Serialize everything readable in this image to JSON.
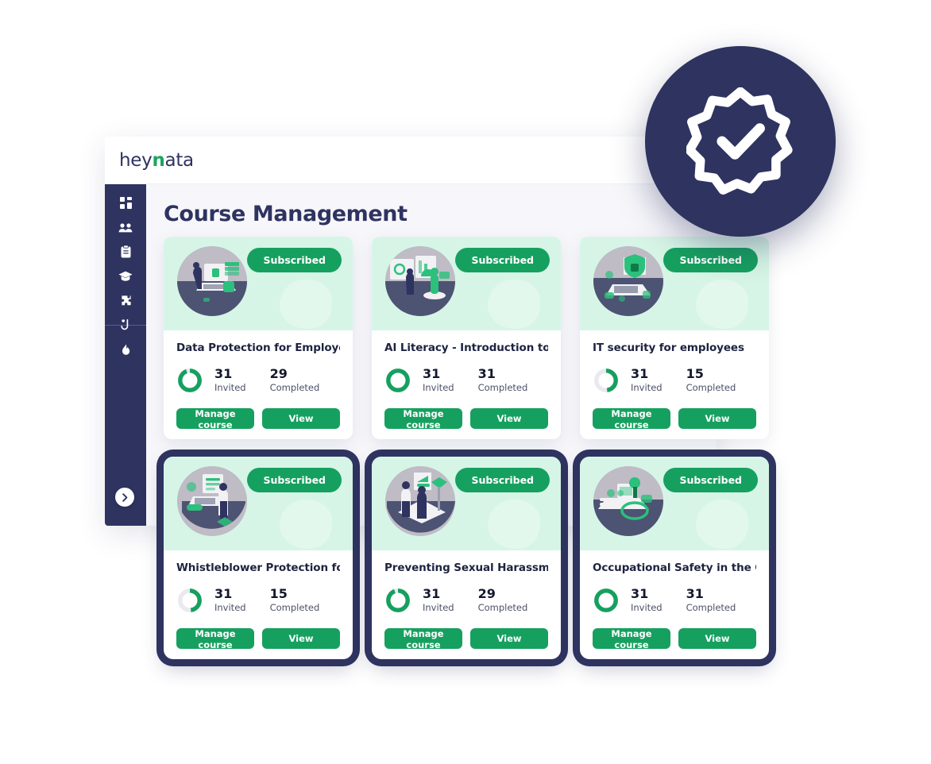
{
  "app": {
    "logo_prefix": "hey",
    "logo_accent": "n",
    "logo_suffix": "ata",
    "page_title": "Course Management"
  },
  "sidebar": {
    "items": [
      {
        "icon": "dashboard-grid-icon",
        "label": "Dashboard"
      },
      {
        "icon": "users-group-icon",
        "label": "Users"
      },
      {
        "icon": "clipboard-icon",
        "label": "Reports"
      },
      {
        "icon": "graduation-cap-icon",
        "label": "Courses"
      },
      {
        "icon": "puzzle-piece-icon",
        "label": "Integrations"
      },
      {
        "icon": "hook-icon",
        "label": "Phishing"
      },
      {
        "icon": "flame-icon",
        "label": "Awareness"
      }
    ],
    "toggle": {
      "icon": "chevron-right-icon",
      "label": "Expand sidebar"
    }
  },
  "seal": {
    "icon": "verified-badge-check-icon",
    "label": "Verified"
  },
  "colors": {
    "brand_navy": "#2e3360",
    "brand_green": "#16a05f",
    "hero_mint": "#d6f5e6",
    "content_bg": "#f7f7fb",
    "donut_track": "#e9e9ef"
  },
  "labels": {
    "subscribed": "Subscribed",
    "invited": "Invited",
    "completed": "Completed",
    "manage_course": "Manage course",
    "view": "View"
  },
  "courses": [
    {
      "title": "Data Protection for Employees",
      "status": "Subscribed",
      "invited": "31",
      "completed": "29",
      "progress_percent": 94,
      "illustration": "laptop-lock-data-icon",
      "manage_label": "Manage course",
      "view_label": "View",
      "framed": false
    },
    {
      "title": "AI Literacy - Introduction to...",
      "status": "Subscribed",
      "invited": "31",
      "completed": "31",
      "progress_percent": 100,
      "illustration": "ai-presentation-robot-icon",
      "manage_label": "Manage course",
      "view_label": "View",
      "framed": false
    },
    {
      "title": "IT security for employees",
      "status": "Subscribed",
      "invited": "31",
      "completed": "15",
      "progress_percent": 48,
      "illustration": "laptop-shield-lock-icon",
      "manage_label": "Manage course",
      "view_label": "View",
      "framed": false
    },
    {
      "title": "Whistleblower Protection for...",
      "status": "Subscribed",
      "invited": "31",
      "completed": "15",
      "progress_percent": 48,
      "illustration": "person-laptop-document-icon",
      "manage_label": "Manage course",
      "view_label": "View",
      "framed": true
    },
    {
      "title": "Preventing Sexual Harassment",
      "status": "Subscribed",
      "invited": "31",
      "completed": "29",
      "progress_percent": 94,
      "illustration": "two-people-sign-icon",
      "manage_label": "Manage course",
      "view_label": "View",
      "framed": true
    },
    {
      "title": "Occupational Safety in the Office",
      "status": "Subscribed",
      "invited": "31",
      "completed": "31",
      "progress_percent": 100,
      "illustration": "office-desk-safety-icon",
      "manage_label": "Manage course",
      "view_label": "View",
      "framed": true
    }
  ]
}
